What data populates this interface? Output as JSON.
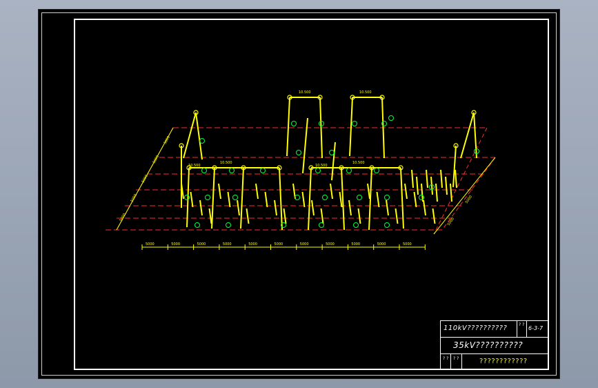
{
  "colors": {
    "background": "#000000",
    "frame": "#ffffff",
    "structure": "#ffff00",
    "grid_dashed": "#ff2a2a",
    "labels": "#00ff3c"
  },
  "title_block": {
    "line1": "110kV??????????",
    "code": "6-3-7",
    "mini_top": "? ?",
    "mini_bottom": "?\n?",
    "line2": "35kV??????????",
    "line3": "????????????",
    "corner_a": "? ?",
    "corner_b": "? ?"
  },
  "dimensions": {
    "bottom": [
      "5000",
      "5000",
      "5000",
      "5000",
      "5000",
      "5000",
      "5000",
      "5000",
      "5000",
      "5000",
      "5000"
    ],
    "left_side": [
      "5000",
      "5000",
      "5000",
      "5000",
      "5000"
    ],
    "right_side": [
      "5000",
      "5000"
    ],
    "beam_tags": [
      "10.500",
      "10.500",
      "10.500",
      "10.500",
      "10.500",
      "10.500"
    ]
  }
}
